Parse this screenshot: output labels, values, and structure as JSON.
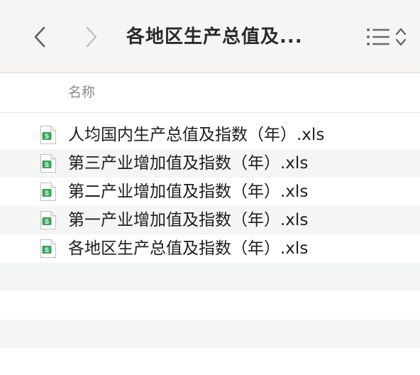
{
  "window": {
    "title": "各地区生产总值及..."
  },
  "toolbar": {
    "back_icon": "chevron-left-icon",
    "forward_icon": "chevron-right-icon",
    "view_icon": "list-view-icon",
    "sort_icon": "up-down-chevron-icon"
  },
  "columns": {
    "name_header": "名称"
  },
  "files": [
    {
      "name": "人均国内生产总值及指数（年）.xls",
      "icon": "spreadsheet-file-icon"
    },
    {
      "name": "第三产业增加值及指数（年）.xls",
      "icon": "spreadsheet-file-icon"
    },
    {
      "name": "第二产业增加值及指数（年）.xls",
      "icon": "spreadsheet-file-icon"
    },
    {
      "name": "第一产业增加值及指数（年）.xls",
      "icon": "spreadsheet-file-icon"
    },
    {
      "name": "各地区生产总值及指数（年）.xls",
      "icon": "spreadsheet-file-icon"
    }
  ],
  "colors": {
    "toolbar_bg": "#f6f5f4",
    "stripe_bg": "#f4f5f5",
    "icon_green": "#3aa35b"
  }
}
